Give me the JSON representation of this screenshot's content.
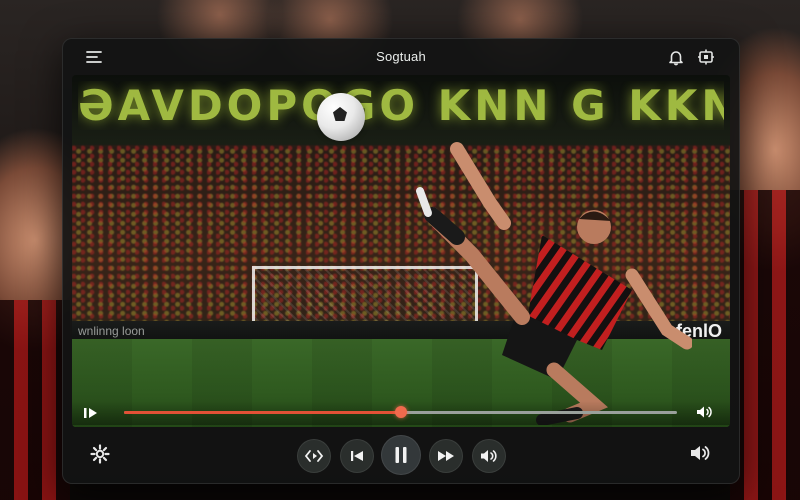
{
  "window": {
    "title": "Sogtuah"
  },
  "icons": {
    "menu": "menu-icon",
    "notifications": "bell-icon",
    "picture_in_picture": "pip-icon",
    "settings": "gear-icon",
    "play_small": "play-pause-icon",
    "volume": "volume-icon",
    "replay": "replay-icon",
    "previous": "skip-previous-icon",
    "pause": "pause-icon",
    "forward": "fast-forward-icon",
    "volume_control": "volume-icon"
  },
  "video": {
    "banner_text": "ƏAVDOPOGO KNN G KKNX KEUQ",
    "adboard_left": "wnlinng loon",
    "adboard_right": "fenlO"
  },
  "playback": {
    "progress": 0.5
  },
  "colors": {
    "accent": "#e25136",
    "window_bg": "#121413",
    "control_bg": "#2a2e2c",
    "jersey_red": "#c21f1f",
    "jersey_black": "#111111"
  }
}
